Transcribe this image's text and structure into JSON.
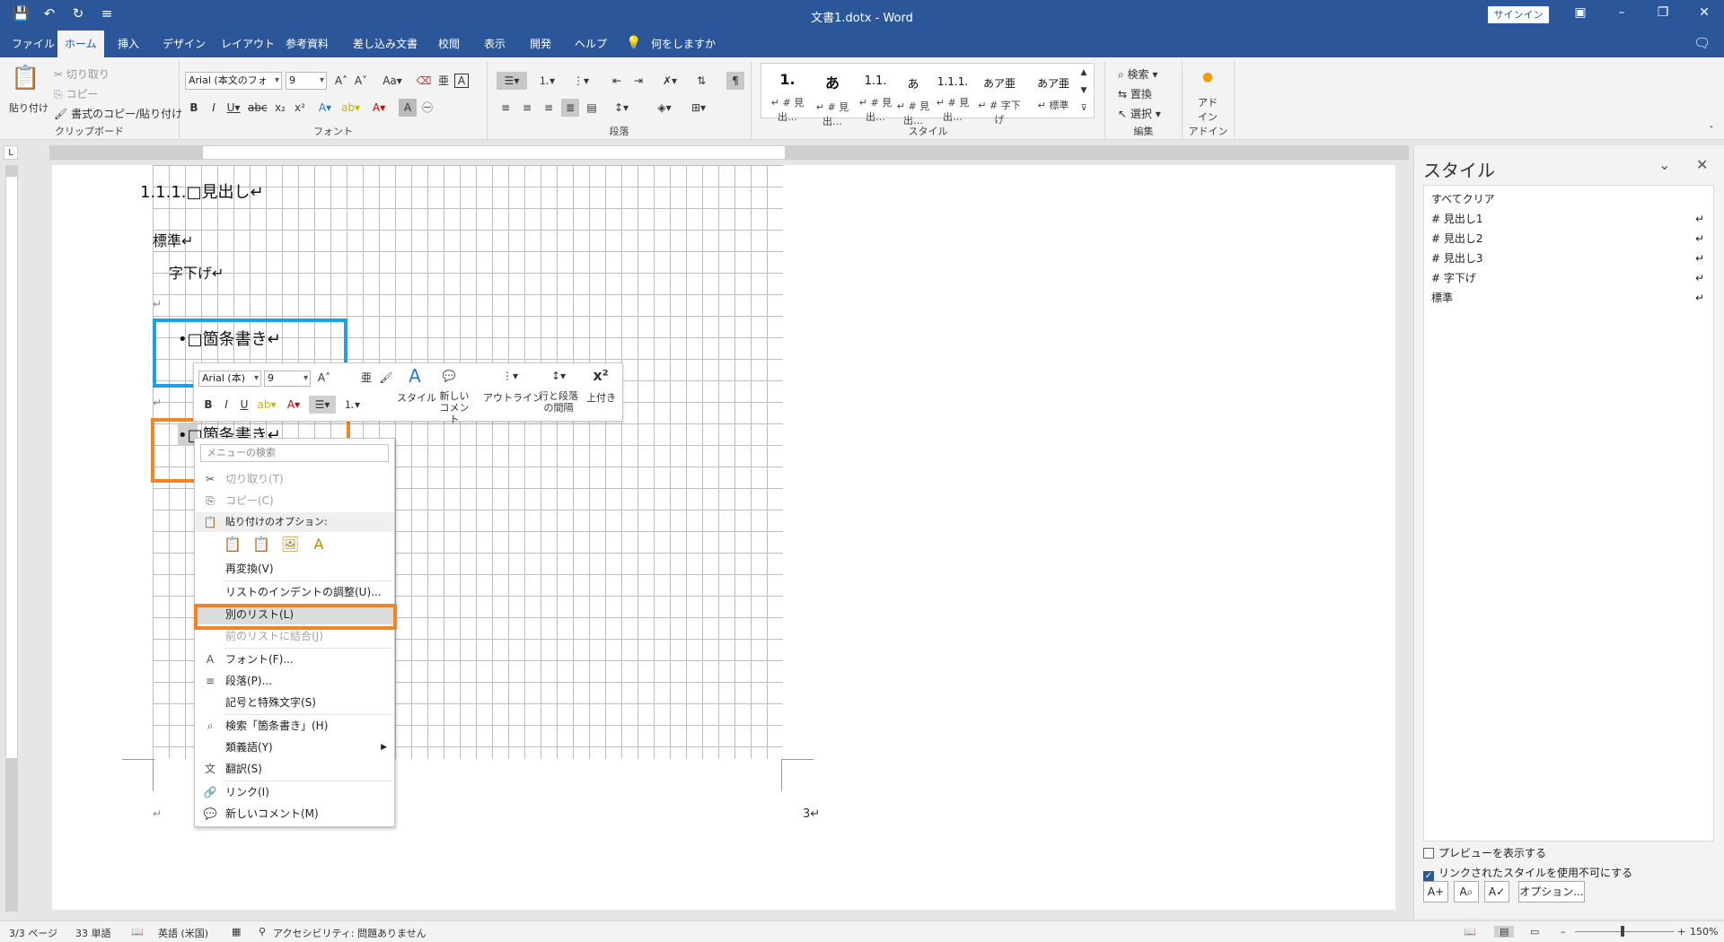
{
  "titlebar": {
    "title": "文書1.dotx  -  Word",
    "signin": "サインイン"
  },
  "tabs": [
    "ファイル",
    "ホーム",
    "挿入",
    "デザイン",
    "レイアウト",
    "参考資料",
    "差し込み文書",
    "校閲",
    "表示",
    "開発",
    "ヘルプ",
    "何をしますか"
  ],
  "ribbon": {
    "clipboard": {
      "paste": "貼り付け",
      "cut": "切り取り",
      "copy": "コピー",
      "format_painter": "書式のコピー/貼り付け",
      "label": "クリップボード"
    },
    "font": {
      "name": "Arial (本文のフォ",
      "size": "9",
      "label": "フォント"
    },
    "paragraph": {
      "label": "段落"
    },
    "styles": {
      "label": "スタイル",
      "items": [
        {
          "big": "1.",
          "cap": "↵ # 見出…"
        },
        {
          "big": "あ",
          "cap": "↵ # 見出…"
        },
        {
          "big": "1.1.",
          "cap": "↵ # 見出…"
        },
        {
          "big": "あ",
          "cap": "↵ # 見出…"
        },
        {
          "big": "1.1.1.",
          "cap": "↵ # 見出…"
        },
        {
          "big": "あ",
          "cap": "↵ # 字下げ"
        },
        {
          "big": "あア亜",
          "cap": "↵ 標準"
        },
        {
          "big": "あア亜",
          "cap": "↵ 標準"
        }
      ]
    },
    "editing": {
      "find": "検索",
      "replace": "置換",
      "select": "選択",
      "label": "編集"
    },
    "addin": {
      "btn": "アド イン",
      "label": "アドイン"
    }
  },
  "document": {
    "heading": "1.1.1.□見出し↵",
    "normal": "標準↵",
    "indent": "字下げ↵",
    "bullet1": "•□箇条書き↵",
    "bullet2": "•□箇条書き↵",
    "para_mark": "↵",
    "page_num": "3↵"
  },
  "minitoolbar": {
    "font": "Arial (本)",
    "size": "9",
    "style": "スタイル",
    "new_comment": "新しい コメント",
    "outline": "アウトライン",
    "spacing": "行と段落 の間隔",
    "superscript": "上付き"
  },
  "contextmenu": {
    "search_placeholder": "メニューの検索",
    "items": [
      {
        "label": "切り取り(T)",
        "icon": "✂",
        "disabled": true
      },
      {
        "label": "コピー(C)",
        "icon": "⎘",
        "disabled": true
      },
      {
        "label": "貼り付けのオプション:",
        "icon": "📋",
        "header": true
      },
      {
        "label": "再変換(V)"
      },
      {
        "label": "リストのインデントの調整(U)..."
      },
      {
        "label": "別のリスト(L)",
        "selected": true
      },
      {
        "label": "前のリストに結合(J)",
        "disabled": true
      },
      {
        "label": "フォント(F)...",
        "icon": "A"
      },
      {
        "label": "段落(P)...",
        "icon": "≡"
      },
      {
        "label": "記号と特殊文字(S)"
      },
      {
        "label": "検索「箇条書き」(H)",
        "icon": "⌕"
      },
      {
        "label": "類義語(Y)",
        "submenu": true
      },
      {
        "label": "翻訳(S)",
        "icon": "文"
      },
      {
        "label": "リンク(I)",
        "icon": "🔗"
      },
      {
        "label": "新しいコメント(M)",
        "icon": "💬"
      }
    ]
  },
  "pane": {
    "title": "スタイル",
    "items": [
      "すべてクリア",
      "# 見出し1",
      "# 見出し2",
      "# 見出し3",
      "# 字下げ",
      "標準"
    ],
    "preview": "プレビューを表示する",
    "disable_linked": "リンクされたスタイルを使用不可にする",
    "options": "オプション..."
  },
  "status": {
    "page": "3/3 ページ",
    "words": "33 単語",
    "lang": "英語 (米国)",
    "access": "アクセシビリティ: 問題ありません",
    "zoom": "150%"
  },
  "colors": {
    "accent": "#2b579a",
    "blue_box": "#1ea1dc",
    "orange_box": "#f08428"
  }
}
